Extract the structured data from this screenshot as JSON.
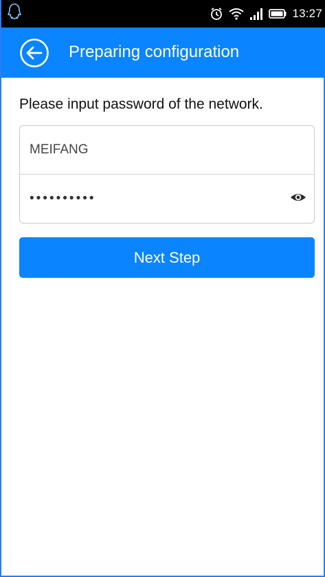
{
  "status_bar": {
    "left_icon": "qq-penguin-icon",
    "icons": [
      "alarm-icon",
      "wifi-icon",
      "signal-icon",
      "battery-icon"
    ],
    "time": "13:27"
  },
  "app_bar": {
    "title": "Preparing configuration",
    "back_icon": "back-arrow-circle-icon",
    "color": "#0a84ff"
  },
  "main": {
    "prompt": "Please input password of the network.",
    "ssid": {
      "value": "MEIFANG"
    },
    "password": {
      "value": "••••••••••",
      "toggle_icon": "eye-icon"
    },
    "next_button": {
      "label": "Next Step"
    }
  }
}
